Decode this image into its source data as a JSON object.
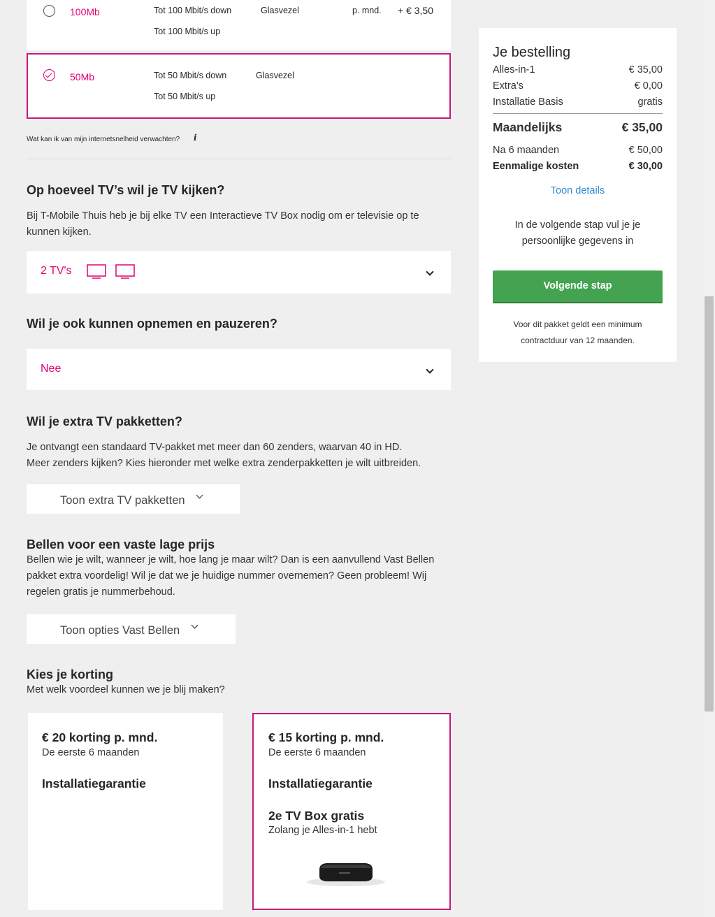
{
  "speed_options": [
    {
      "name": "100Mb",
      "down": "Tot 100 Mbit/s down",
      "up": "Tot 100 Mbit/s up",
      "type": "Glasvezel",
      "price_unit": "p. mnd.",
      "price": "+ € 3,50",
      "selected": false
    },
    {
      "name": "50Mb",
      "down": "Tot 50 Mbit/s down",
      "up": "Tot 50 Mbit/s up",
      "type": "Glasvezel",
      "selected": true
    }
  ],
  "speed_info_link": "Wat kan ik van mijn internetsnelheid verwachten?",
  "tv": {
    "heading": "Op hoeveel TV’s wil je TV kijken?",
    "description": "Bij T-Mobile Thuis heb je bij elke TV een Interactieve TV Box nodig om er televisie op te kunnen kijken.",
    "selected_value": "2 TV's",
    "icon": "tv-icon"
  },
  "recording": {
    "heading": "Wil je ook kunnen opnemen en pauzeren?",
    "selected_value": "Nee"
  },
  "tv_packages": {
    "heading": "Wil je extra TV pakketten?",
    "description_line1": "Je ontvangt een standaard TV-pakket met meer dan 60 zenders, waarvan 40 in HD.",
    "description_line2": "Meer zenders kijken? Kies hieronder met welke extra zenderpakketten je wilt uitbreiden.",
    "button_label": "Toon extra TV pakketten"
  },
  "calling": {
    "heading": "Bellen voor een vaste lage prijs",
    "description": "Bellen wie je wilt, wanneer je wilt, hoe lang je maar wilt? Dan is een aanvullend Vast Bellen pakket extra voordelig! Wil je dat we je huidige nummer overnemen? Geen probleem! Wij regelen gratis je nummerbehoud.",
    "button_label": "Toon opties Vast Bellen"
  },
  "discount": {
    "heading": "Kies je korting",
    "subheading": "Met welk voordeel kunnen we je blij maken?",
    "options": [
      {
        "title": "€ 20 korting p. mnd.",
        "subtitle": "De eerste 6 maanden",
        "feature": "Installatiegarantie",
        "selected": false
      },
      {
        "title": "€ 15 korting p. mnd.",
        "subtitle": "De eerste 6 maanden",
        "feature": "Installatiegarantie",
        "extra_title": "2e TV Box gratis",
        "extra_subtitle": "Zolang je Alles-in-1 hebt",
        "selected": true
      }
    ]
  },
  "order": {
    "title": "Je bestelling",
    "lines": [
      {
        "label": "Alles-in-1",
        "value": "€ 35,00"
      },
      {
        "label": "Extra's",
        "value": "€ 0,00"
      },
      {
        "label": "Installatie Basis",
        "value": "gratis"
      }
    ],
    "monthly_label": "Maandelijks",
    "monthly_value": "€ 35,00",
    "after_label": "Na 6 maanden",
    "after_value": "€ 50,00",
    "onetime_label": "Eenmalige kosten",
    "onetime_value": "€ 30,00",
    "details_link": "Toon details",
    "next_note_line1": "In de volgende stap vul je je",
    "next_note_line2": "persoonlijke gegevens in",
    "next_button": "Volgende stap",
    "contract_note_line1": "Voor dit pakket geldt een minimum",
    "contract_note_line2": "contractduur van 12 maanden."
  },
  "colors": {
    "brand": "#e20074",
    "button_green": "#43a351",
    "link_blue": "#2f8dcd"
  }
}
